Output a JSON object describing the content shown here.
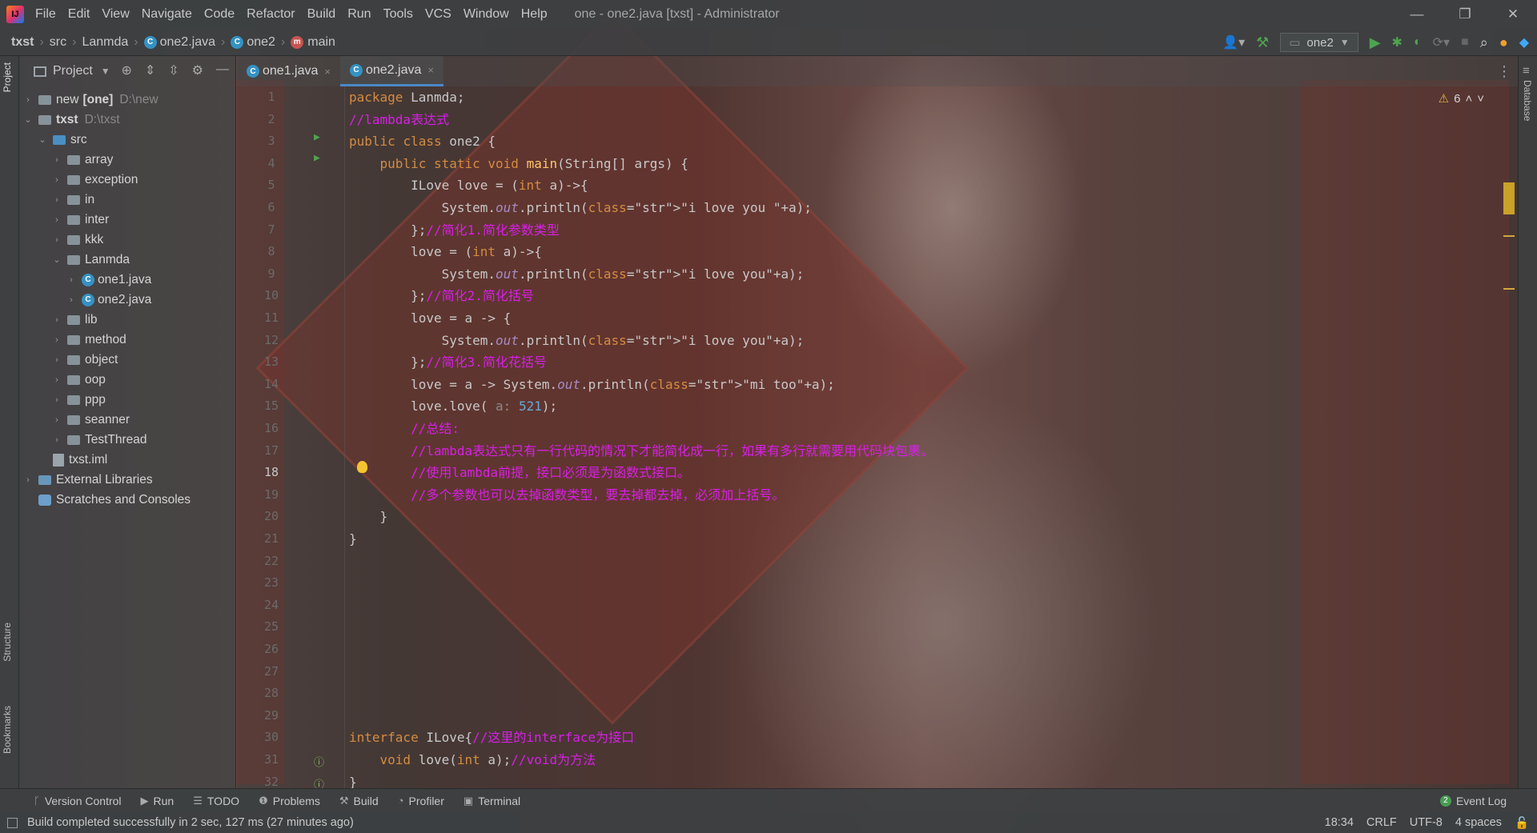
{
  "menubar": {
    "logo_text": "IJ",
    "items": [
      "File",
      "Edit",
      "View",
      "Navigate",
      "Code",
      "Refactor",
      "Build",
      "Run",
      "Tools",
      "VCS",
      "Window",
      "Help"
    ],
    "window_title": "one - one2.java [txst] - Administrator",
    "window_controls": [
      "—",
      "❐",
      "✕"
    ]
  },
  "navbar": {
    "breadcrumbs": [
      "txst",
      "src",
      "Lanmda",
      "one2.java",
      "one2",
      "main"
    ],
    "run_config": "one2"
  },
  "project_panel": {
    "title": "Project",
    "tree": [
      {
        "label": "new",
        "suffix": "[one]",
        "path": "D:\\new",
        "level": 0,
        "arrow": "›",
        "type": "module"
      },
      {
        "label": "txst",
        "path": "D:\\txst",
        "level": 0,
        "arrow": "⌄",
        "type": "module"
      },
      {
        "label": "src",
        "level": 1,
        "arrow": "⌄",
        "type": "src"
      },
      {
        "label": "array",
        "level": 2,
        "arrow": "›",
        "type": "folder"
      },
      {
        "label": "exception",
        "level": 2,
        "arrow": "›",
        "type": "folder"
      },
      {
        "label": "in",
        "level": 2,
        "arrow": "›",
        "type": "folder"
      },
      {
        "label": "inter",
        "level": 2,
        "arrow": "›",
        "type": "folder"
      },
      {
        "label": "kkk",
        "level": 2,
        "arrow": "›",
        "type": "folder"
      },
      {
        "label": "Lanmda",
        "level": 2,
        "arrow": "⌄",
        "type": "folder"
      },
      {
        "label": "one1.java",
        "level": 3,
        "arrow": "›",
        "type": "class"
      },
      {
        "label": "one2.java",
        "level": 3,
        "arrow": "›",
        "type": "class"
      },
      {
        "label": "lib",
        "level": 2,
        "arrow": "›",
        "type": "folder"
      },
      {
        "label": "method",
        "level": 2,
        "arrow": "›",
        "type": "folder"
      },
      {
        "label": "object",
        "level": 2,
        "arrow": "›",
        "type": "folder"
      },
      {
        "label": "oop",
        "level": 2,
        "arrow": "›",
        "type": "folder"
      },
      {
        "label": "ppp",
        "level": 2,
        "arrow": "›",
        "type": "folder"
      },
      {
        "label": "seanner",
        "level": 2,
        "arrow": "›",
        "type": "folder"
      },
      {
        "label": "TestThread",
        "level": 2,
        "arrow": "›",
        "type": "folder"
      },
      {
        "label": "txst.iml",
        "level": 1,
        "arrow": "",
        "type": "iml"
      },
      {
        "label": "External Libraries",
        "level": 0,
        "arrow": "›",
        "type": "ext"
      },
      {
        "label": "Scratches and Consoles",
        "level": 0,
        "arrow": "",
        "type": "scratch"
      }
    ]
  },
  "side_labels": {
    "project": "Project",
    "structure": "Structure",
    "bookmarks": "Bookmarks",
    "database": "Database"
  },
  "tabs": [
    {
      "label": "one1.java",
      "active": false,
      "close": "×"
    },
    {
      "label": "one2.java",
      "active": true,
      "close": "×"
    }
  ],
  "editor": {
    "warning_count": "6",
    "current_line": 18,
    "lines": [
      "package Lanmda;",
      "//lambda表达式",
      "public class one2 {",
      "    public static void main(String[] args) {",
      "        ILove love = (int a)->{",
      "            System.out.println(\"i love you \"+a);",
      "        };//简化1.简化参数类型",
      "        love = (int a)->{",
      "            System.out.println(\"i love you\"+a);",
      "        };//简化2.简化括号",
      "        love = a -> {",
      "            System.out.println(\"i love you\"+a);",
      "        };//简化3.简化花括号",
      "        love = a -> System.out.println(\"mi too\"+a);",
      "        love.love( a: 521);",
      "        //总结:",
      "        //lambda表达式只有一行代码的情况下才能简化成一行，如果有多行就需要用代码块包裹。",
      "        //使用lambda前提，接口必须是为函数式接口。",
      "        //多个参数也可以去掉函数类型，要去掉都去掉，必须加上括号。",
      "    }",
      "}",
      "",
      "",
      "",
      "",
      "",
      "",
      "",
      "",
      "interface ILove{//这里的interface为接口",
      "    void love(int a);//void为方法",
      "}"
    ]
  },
  "bottom_tools": [
    "Version Control",
    "Run",
    "TODO",
    "Problems",
    "Build",
    "Profiler",
    "Terminal"
  ],
  "event_log": {
    "label": "Event Log",
    "count": "2"
  },
  "status": {
    "message": "Build completed successfully in 2 sec, 127 ms (27 minutes ago)",
    "position": "18:34",
    "line_sep": "CRLF",
    "encoding": "UTF-8",
    "indent": "4 spaces"
  }
}
